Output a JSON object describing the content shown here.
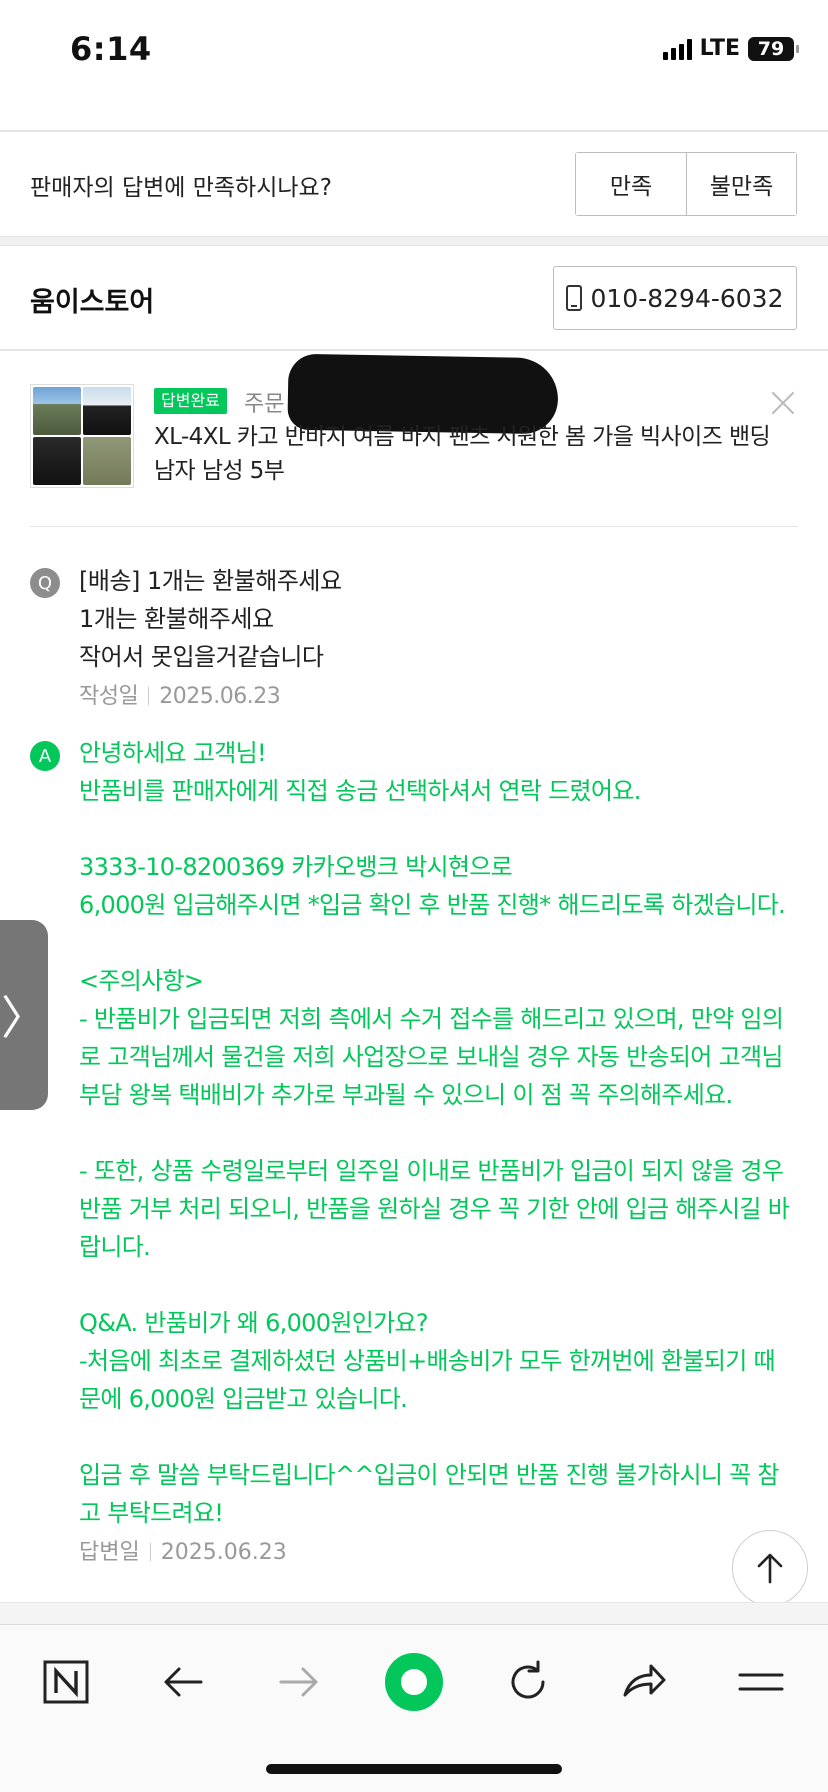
{
  "status_bar": {
    "time": "6:14",
    "network": "LTE",
    "battery": "79"
  },
  "satisfaction": {
    "question": "판매자의 답변에 만족하시나요?",
    "satisfied_label": "만족",
    "unsatisfied_label": "불만족"
  },
  "store": {
    "name": "움이스토어",
    "phone": "010-8294-6032"
  },
  "product": {
    "badge": "답변완료",
    "order_prefix": "주문",
    "name": "XL-4XL 카고 반바지 여름 바지 팬츠 시원한 봄 가을 빅사이즈 밴딩 남자 남성 5부"
  },
  "question": {
    "badge": "Q",
    "lines": [
      "[배송] 1개는 환불해주세요",
      "1개는 환불해주세요",
      "작어서 못입을거같습니다"
    ],
    "date_label": "작성일",
    "date": "2025.06.23"
  },
  "answer": {
    "badge": "A",
    "lines": [
      "안녕하세요 고객님!",
      "반품비를 판매자에게 직접 송금 선택하셔서 연락 드렸어요.",
      "",
      "3333-10-8200369 카카오뱅크 박시현으로",
      "6,000원 입금해주시면 *입금 확인 후 반품 진행* 해드리도록 하겠습니다.",
      "",
      "<주의사항>",
      "- 반품비가 입금되면 저희 측에서 수거 접수를 해드리고 있으며, 만약 임의",
      "로 고객님께서 물건을 저희 사업장으로 보내실 경우 자동 반송되어 고객님",
      "부담 왕복 택배비가 추가로 부과될 수 있으니 이 점 꼭 주의해주세요.",
      "",
      "- 또한, 상품 수령일로부터 일주일 이내로 반품비가 입금이 되지 않을 경우",
      "반품 거부 처리 되오니, 반품을 원하실 경우 꼭 기한 안에 입금 해주시길 바",
      "랍니다.",
      "",
      "Q&A. 반품비가 왜 6,000원인가요?",
      "-처음에 최초로 결제하셨던 상품비+배송비가 모두 한꺼번에 환불되기 때",
      "문에 6,000원 입금받고 있습니다.",
      "",
      "입금 후 말씀 부탁드립니다^^입금이 안되면 반품 진행 불가하시니 꼭 참",
      "고 부탁드려요!"
    ],
    "date_label": "답변일",
    "date": "2025.06.23"
  },
  "side_tab": {
    "glyph": "〉"
  },
  "colors": {
    "accent": "#03c75a",
    "question_badge": "#8d8d8d"
  },
  "bottom_nav": {
    "icons": [
      "naver-home-icon",
      "back-arrow-icon",
      "forward-arrow-icon",
      "green-dot-icon",
      "refresh-icon",
      "share-icon",
      "menu-icon"
    ]
  }
}
